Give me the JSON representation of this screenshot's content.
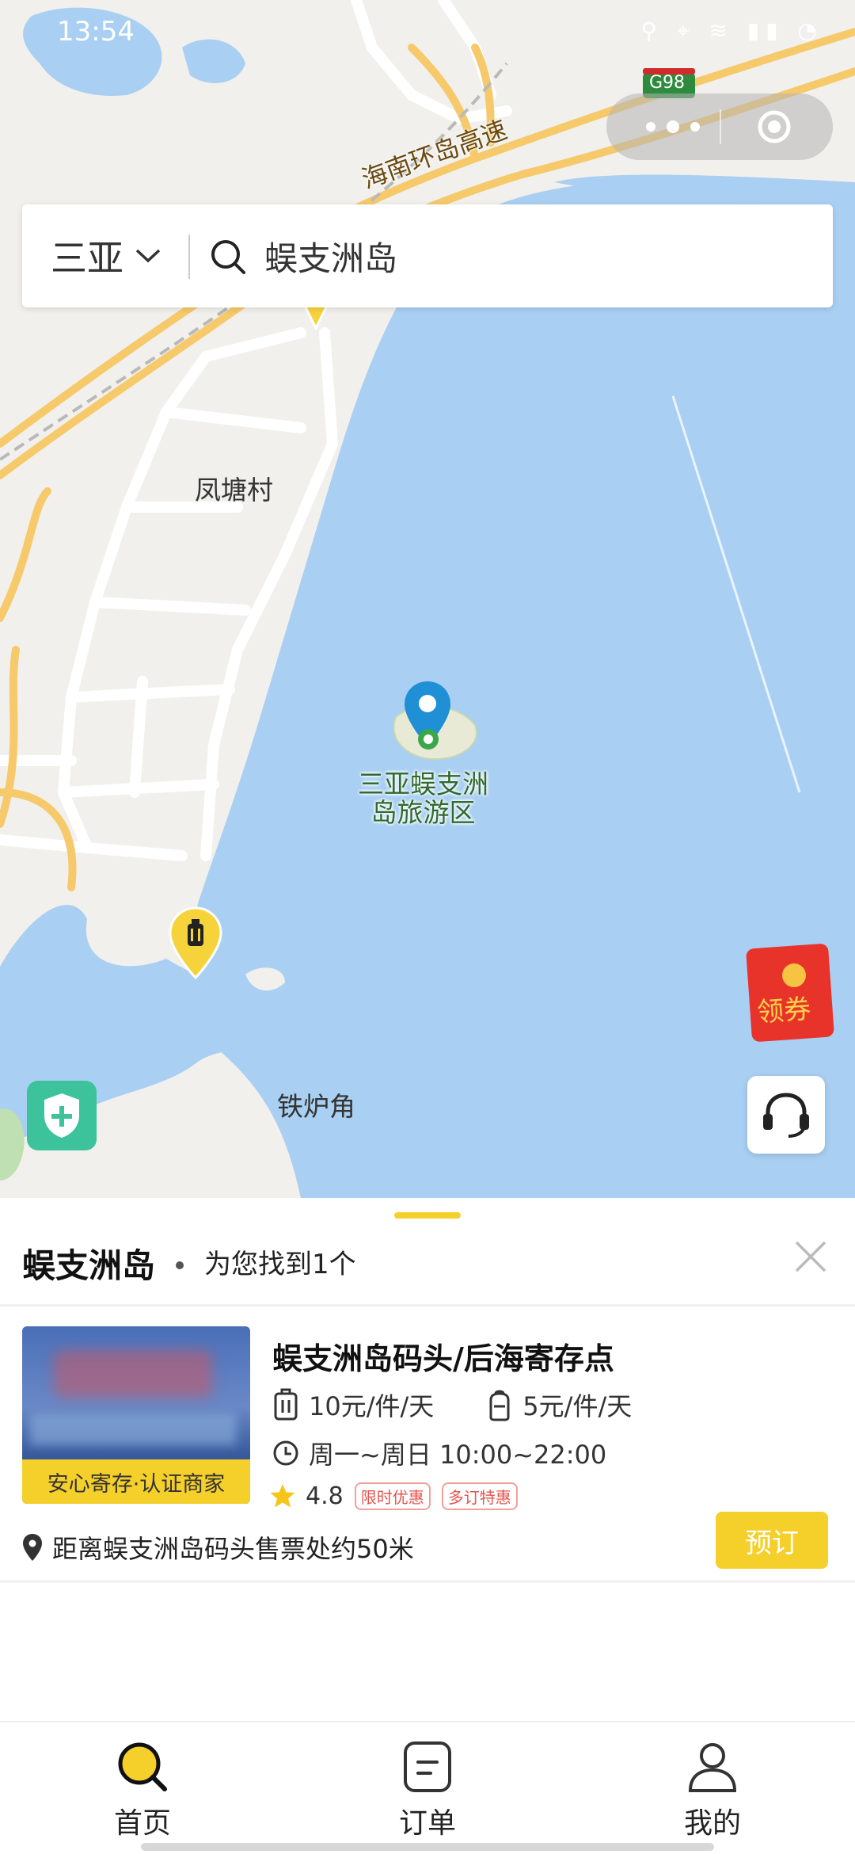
{
  "status_bar": {
    "time": "13:54",
    "icons": "⚲ ⌖ ≋ ▮▮ ◔"
  },
  "search": {
    "city": "三亚",
    "query": "蜈支洲岛"
  },
  "map": {
    "road_labels": [
      "海南环岛高速",
      "G98"
    ],
    "place_labels": [
      "凤塘村",
      "铁炉角"
    ],
    "poi_label_line1": "三亚蜈支洲",
    "poi_label_line2": "岛旅游区"
  },
  "coupon": {
    "label": "领券"
  },
  "results": {
    "title": "蜈支洲岛",
    "count_text": "为您找到1个"
  },
  "store": {
    "badge": "安心寄存·认证商家",
    "name": "蜈支洲岛码头/后海寄存点",
    "price_luggage": "10元/件/天",
    "price_bag": "5元/件/天",
    "hours": "周一~周日 10:00~22:00",
    "rating": "4.8",
    "tags": [
      "限时优惠",
      "多订特惠"
    ],
    "distance": "距离蜈支洲岛码头售票处约50米",
    "book_label": "预订"
  },
  "tabs": [
    {
      "label": "首页",
      "icon": "search-icon",
      "active": true
    },
    {
      "label": "订单",
      "icon": "order-list-icon",
      "active": false
    },
    {
      "label": "我的",
      "icon": "user-profile-icon",
      "active": false
    }
  ],
  "colors": {
    "accent": "#f5cf2a",
    "sea": "#a9cff2",
    "land": "#f1f0ec",
    "road": "#f6c96a",
    "shield": "#3cc39b",
    "pin": "#1f8fd6"
  }
}
